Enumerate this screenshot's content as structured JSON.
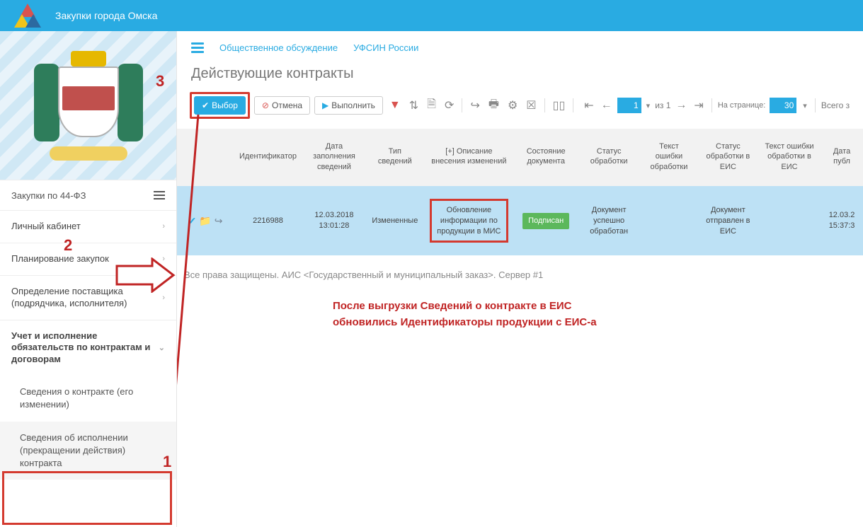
{
  "header": {
    "title": "Закупки города Омска"
  },
  "sidebar": {
    "section_label": "Закупки по 44-ФЗ",
    "items": [
      {
        "label": "Личный кабинет"
      },
      {
        "label": "Планирование закупок"
      },
      {
        "label": "Определение поставщика (подрядчика, исполнителя)"
      },
      {
        "label": "Учет и исполнение обязательств по контрактам и договорам"
      }
    ],
    "subs": [
      {
        "label": "Сведения о контракте (его изменении)"
      },
      {
        "label": "Сведения об исполнении (прекращении действия) контракта"
      }
    ]
  },
  "breadcrumb": {
    "a": "Общественное обсуждение",
    "b": "УФСИН России"
  },
  "page": {
    "title": "Действующие контракты"
  },
  "toolbar": {
    "select_label": "Выбор",
    "cancel_label": "Отмена",
    "execute_label": "Выполнить",
    "page_current": "1",
    "page_of": "из 1",
    "perpage_label": "На странице:",
    "perpage_value": "30",
    "total_label": "Всего з"
  },
  "grid": {
    "columns": [
      "",
      "Идентификатор",
      "Дата заполнения сведений",
      "Тип сведений",
      "[+] Описание внесения изменений",
      "Состояние документа",
      "Статус обработки",
      "Текст ошибки обработки",
      "Статус обработки в ЕИС",
      "Текст ошибки обработки в ЕИС",
      "Дата публ"
    ],
    "row": {
      "id": "2216988",
      "date": "12.03.2018 13:01:28",
      "type": "Измененные",
      "change": "Обновление информации по продукции в МИС",
      "state": "Подписан",
      "proc": "Документ успешно обработан",
      "eis": "Документ отправлен в ЕИС",
      "pub": "12.03.2 15:37:3"
    }
  },
  "footer": "Все права защищены. АИС <Государственный и муниципальный заказ>. Сервер #1",
  "note_l1": "После выгрузки Сведений о контракте в ЕИС",
  "note_l2": "обновились Идентификаторы продукции с ЕИС-а",
  "anno": {
    "n1": "1",
    "n2": "2",
    "n3": "3"
  }
}
